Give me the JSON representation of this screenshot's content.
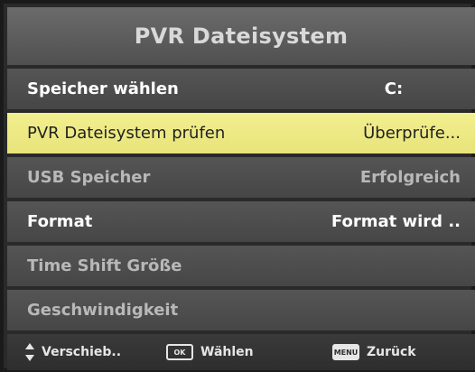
{
  "title": "PVR Dateisystem",
  "rows": [
    {
      "label": "Speicher wählen",
      "value": "C:"
    },
    {
      "label": "PVR Dateisystem prüfen",
      "value": "Überprüfe..."
    },
    {
      "label": "USB Speicher",
      "value": "Erfolgreich"
    },
    {
      "label": "Format",
      "value": "Format wird .."
    },
    {
      "label": "Time Shift Größe",
      "value": ""
    },
    {
      "label": "Geschwindigkeit",
      "value": ""
    }
  ],
  "footer": {
    "move_label": "Verschieb..",
    "ok_key": "OK",
    "select_label": "Wählen",
    "menu_key": "MENU",
    "back_label": "Zurück"
  },
  "colors": {
    "highlight": "#f2ef8f",
    "row_bg": "#4e4e4e",
    "title_bg": "#5e5e5e"
  }
}
